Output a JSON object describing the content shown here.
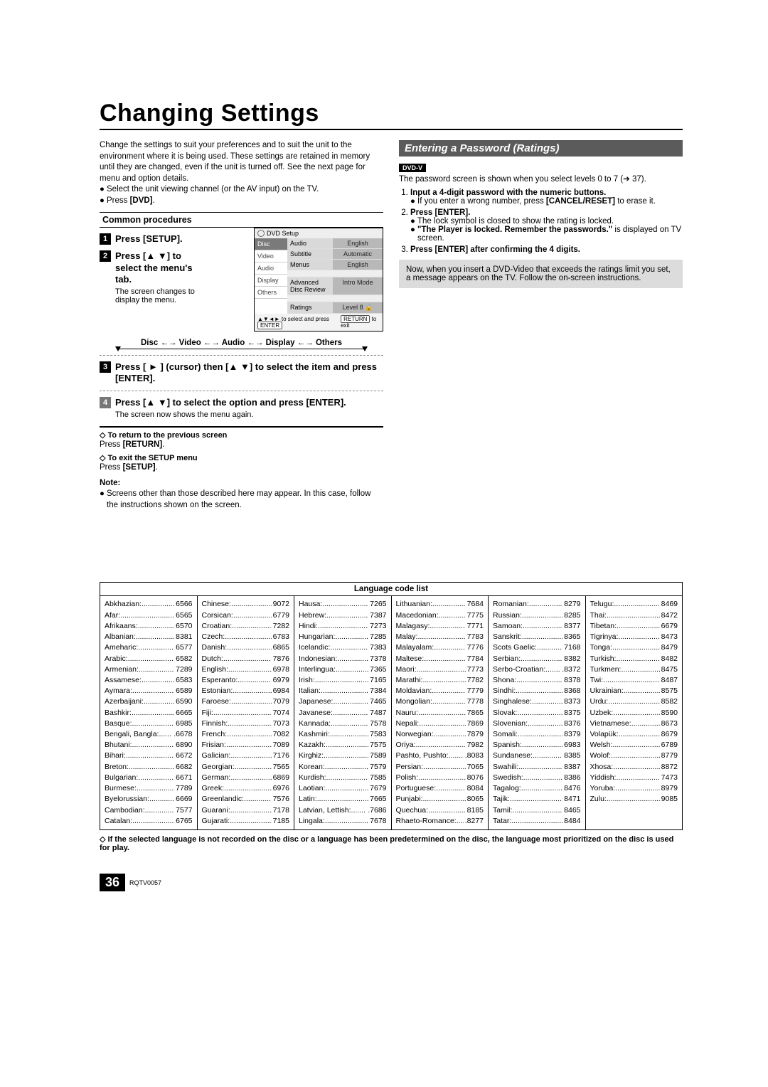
{
  "page_number": "36",
  "doc_code": "RQTV0057",
  "title": "Changing Settings",
  "intro": "Change the settings to suit your preferences and to suit the unit to the environment where it is being used. These settings are retained in memory until they are changed, even if the unit is turned off. See the next page for menu and option details.",
  "intro_b1": "Select the unit viewing channel (or the AV input) on the TV.",
  "intro_b2_a": "Press ",
  "intro_b2_b": "[DVD]",
  "intro_b2_c": ".",
  "common_proc": "Common procedures",
  "step1": "Press [SETUP].",
  "step2": "Press [▲ ▼] to select the menu's tab.",
  "step2_sub": "The screen changes to display the menu.",
  "tv": {
    "head": "DVD Setup",
    "tabs": [
      "Disc",
      "Video",
      "Audio",
      "Display",
      "Others"
    ],
    "rows": [
      {
        "l": "Audio",
        "r": "English"
      },
      {
        "l": "Subtitle",
        "r": "Automatic"
      },
      {
        "l": "Menus",
        "r": "English"
      },
      {
        "l": "",
        "r": ""
      },
      {
        "l": "Advanced Disc Review",
        "r": "Intro Mode"
      },
      {
        "l": "",
        "r": ""
      },
      {
        "l": "Ratings",
        "r": "Level 8 🔓"
      }
    ],
    "foot_l": "▲▼◄► to select and press",
    "foot_l_btn": "ENTER",
    "foot_r_btn": "RETURN",
    "foot_r": "to exit"
  },
  "nav_chain": "Disc ←→ Video ←→ Audio ←→ Display ←→ Others",
  "step3": "Press [ ► ] (cursor) then [▲ ▼] to select the item and press [ENTER].",
  "step4": "Press [▲ ▼] to select the option and press [ENTER].",
  "step4_sub": "The screen now shows the menu again.",
  "return_h": "To return to the previous screen",
  "return_t_a": "Press ",
  "return_t_b": "[RETURN]",
  "return_t_c": ".",
  "exit_h": "To exit the SETUP menu",
  "exit_t_a": "Press ",
  "exit_t_b": "[SETUP]",
  "exit_t_c": ".",
  "note_h": "Note:",
  "note_t": "Screens other than those described here may appear. In this case, follow the instructions shown on the screen.",
  "right": {
    "heading": "Entering a Password (Ratings)",
    "badge": "DVD-V",
    "intro": "The password screen is shown when you select levels 0 to 7 (➔ 37).",
    "s1": "Input a 4-digit password with the numeric buttons.",
    "s1b_a": "If you enter a wrong number, press ",
    "s1b_b": "[CANCEL/RESET]",
    "s1b_c": " to erase it.",
    "s2": "Press [ENTER].",
    "s2a": "The lock symbol is closed to show the rating is locked.",
    "s2b_a": "\"The Player is locked. Remember the passwords.\"",
    "s2b_b": " is displayed on TV screen.",
    "s3": "Press [ENTER] after confirming the 4 digits.",
    "gray": "Now, when you insert a DVD-Video that exceeds the ratings limit you set, a message appears on the TV. Follow the on-screen instructions."
  },
  "lang_title": "Language code list",
  "lang_cols": [
    [
      [
        "Abkhazian:",
        "6566"
      ],
      [
        "Afar:",
        "6565"
      ],
      [
        "Afrikaans:",
        "6570"
      ],
      [
        "Albanian:",
        "8381"
      ],
      [
        "Ameharic:",
        "6577"
      ],
      [
        "Arabic:",
        "6582"
      ],
      [
        "Armenian:",
        "7289"
      ],
      [
        "Assamese:",
        "6583"
      ],
      [
        "Aymara:",
        "6589"
      ],
      [
        "Azerbaijani:",
        "6590"
      ],
      [
        "Bashkir:",
        "6665"
      ],
      [
        "Basque:",
        "6985"
      ],
      [
        "Bengali, Bangla:",
        ".6678"
      ],
      [
        "Bhutani:",
        "6890"
      ],
      [
        "Bihari:",
        "6672"
      ],
      [
        "Breton:",
        "6682"
      ],
      [
        "Bulgarian:",
        "6671"
      ],
      [
        "Burmese:",
        "7789"
      ],
      [
        "Byelorussian:",
        "6669"
      ],
      [
        "Cambodian:",
        "7577"
      ],
      [
        "Catalan:",
        "6765"
      ]
    ],
    [
      [
        "Chinese:",
        "9072"
      ],
      [
        "Corsican:",
        "6779"
      ],
      [
        "Croatian:",
        "7282"
      ],
      [
        "Czech:",
        "6783"
      ],
      [
        "Danish:",
        "6865"
      ],
      [
        "Dutch:",
        "7876"
      ],
      [
        "English:",
        "6978"
      ],
      [
        "Esperanto:",
        "6979"
      ],
      [
        "Estonian:",
        "6984"
      ],
      [
        "Faroese:",
        "7079"
      ],
      [
        "Fiji:",
        "7074"
      ],
      [
        "Finnish:",
        "7073"
      ],
      [
        "French:",
        "7082"
      ],
      [
        "Frisian:",
        "7089"
      ],
      [
        "Galician:",
        "7176"
      ],
      [
        "Georgian:",
        "7565"
      ],
      [
        "German:",
        "6869"
      ],
      [
        "Greek:",
        "6976"
      ],
      [
        "Greenlandic:",
        "7576"
      ],
      [
        "Guarani:",
        "7178"
      ],
      [
        "Gujarati:",
        "7185"
      ]
    ],
    [
      [
        "Hausa:",
        "7265"
      ],
      [
        "Hebrew:",
        "7387"
      ],
      [
        "Hindi:",
        "7273"
      ],
      [
        "Hungarian:",
        "7285"
      ],
      [
        "Icelandic:",
        "7383"
      ],
      [
        "Indonesian:",
        "7378"
      ],
      [
        "Interlingua:",
        "7365"
      ],
      [
        "Irish:",
        "7165"
      ],
      [
        "Italian:",
        "7384"
      ],
      [
        "Japanese:",
        "7465"
      ],
      [
        "Javanese:",
        "7487"
      ],
      [
        "Kannada:",
        "7578"
      ],
      [
        "Kashmiri:",
        "7583"
      ],
      [
        "Kazakh:",
        "7575"
      ],
      [
        "Kirghiz:",
        "7589"
      ],
      [
        "Korean:",
        "7579"
      ],
      [
        "Kurdish:",
        "7585"
      ],
      [
        "Laotian:",
        "7679"
      ],
      [
        "Latin:",
        "7665"
      ],
      [
        "Latvian, Lettish:",
        ".7686"
      ],
      [
        "Lingala:",
        "7678"
      ]
    ],
    [
      [
        "Lithuanian:",
        "7684"
      ],
      [
        "Macedonian:",
        "7775"
      ],
      [
        "Malagasy:",
        "7771"
      ],
      [
        "Malay:",
        "7783"
      ],
      [
        "Malayalam:",
        "7776"
      ],
      [
        "Maltese:",
        "7784"
      ],
      [
        "Maori:",
        "7773"
      ],
      [
        "Marathi:",
        "7782"
      ],
      [
        "Moldavian:",
        "7779"
      ],
      [
        "Mongolian:",
        "7778"
      ],
      [
        "Nauru:",
        "7865"
      ],
      [
        "Nepali:",
        "7869"
      ],
      [
        "Norwegian:",
        "7879"
      ],
      [
        "Oriya:",
        "7982"
      ],
      [
        "Pashto, Pushto:",
        ".8083"
      ],
      [
        "Persian:",
        "7065"
      ],
      [
        "Polish:",
        "8076"
      ],
      [
        "Portuguese:",
        "8084"
      ],
      [
        "Punjabi:",
        "8065"
      ],
      [
        "Quechua:",
        "8185"
      ],
      [
        "Rhaeto-Romance:",
        ".8277"
      ]
    ],
    [
      [
        "Romanian:",
        "8279"
      ],
      [
        "Russian:",
        "8285"
      ],
      [
        "Samoan:",
        "8377"
      ],
      [
        "Sanskrit:",
        "8365"
      ],
      [
        "Scots Gaelic:",
        "7168"
      ],
      [
        "Serbian:",
        "8382"
      ],
      [
        "Serbo-Croatian:",
        ".8372"
      ],
      [
        "Shona:",
        "8378"
      ],
      [
        "Sindhi:",
        "8368"
      ],
      [
        "Singhalese:",
        "8373"
      ],
      [
        "Slovak:",
        "8375"
      ],
      [
        "Slovenian:",
        "8376"
      ],
      [
        "Somali:",
        "8379"
      ],
      [
        "Spanish:",
        "6983"
      ],
      [
        "Sundanese:",
        "8385"
      ],
      [
        "Swahili:",
        "8387"
      ],
      [
        "Swedish:",
        "8386"
      ],
      [
        "Tagalog:",
        "8476"
      ],
      [
        "Tajik:",
        "8471"
      ],
      [
        "Tamil:",
        "8465"
      ],
      [
        "Tatar:",
        "8484"
      ]
    ],
    [
      [
        "Telugu:",
        "8469"
      ],
      [
        "Thai:",
        "8472"
      ],
      [
        "Tibetan:",
        "6679"
      ],
      [
        "Tigrinya:",
        "8473"
      ],
      [
        "Tonga:",
        "8479"
      ],
      [
        "Turkish:",
        "8482"
      ],
      [
        "Turkmen:",
        "8475"
      ],
      [
        "Twi:",
        "8487"
      ],
      [
        "Ukrainian:",
        "8575"
      ],
      [
        "Urdu:",
        "8582"
      ],
      [
        "Uzbek:",
        "8590"
      ],
      [
        "Vietnamese:",
        "8673"
      ],
      [
        "Volapük:",
        "8679"
      ],
      [
        "Welsh:",
        "6789"
      ],
      [
        "Wolof:",
        "8779"
      ],
      [
        "Xhosa:",
        "8872"
      ],
      [
        "Yiddish:",
        "7473"
      ],
      [
        "Yoruba:",
        "8979"
      ],
      [
        "Zulu:",
        "9085"
      ]
    ]
  ],
  "lang_foot": "If the selected language is not recorded on the disc or a language has been predetermined on the disc, the language most prioritized on the disc is used for play."
}
